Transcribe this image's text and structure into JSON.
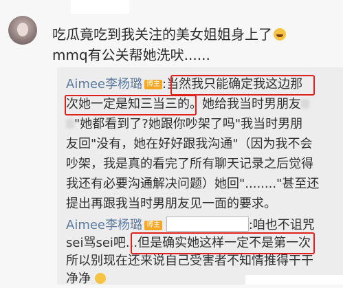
{
  "comment": {
    "line1": "吃瓜竟吃到我关注的美女姐姐身上了",
    "line1_emoji": "laughing-crying-emoji",
    "line2": "mmq有公关帮她洗吠......"
  },
  "reply1": {
    "username": "Aimee李杨璐",
    "badge": "博主",
    "l1_rest": ":当然我只能确定我这边那",
    "l2_hl": "次她一定是知三当三的",
    "l2_rest": "。她给我当时男朋友",
    "l3": "\"她都看到了?她跟你吵架了吗\"我当时男朋",
    "l4": "友回\"没有，她在好好跟我沟通\"（因为我不会",
    "l5": "吵架，我是真的看完了所有聊天记录之后觉得",
    "l6": "我还有必要沟通解决问题）她回\"........\"甚至还",
    "l7": "提出再跟我当时男朋友见一面的要求。"
  },
  "reply2": {
    "username": "Aimee李杨璐",
    "badge": "博主",
    "l1_rest": ":咱也不诅咒",
    "l2_start": "sei骂sei吧...",
    "l2_hl": "但是确实她这样一定不是第一次",
    "l3": "所以别现在还来说自己受害者不知情推得干干",
    "l4": "净净"
  }
}
